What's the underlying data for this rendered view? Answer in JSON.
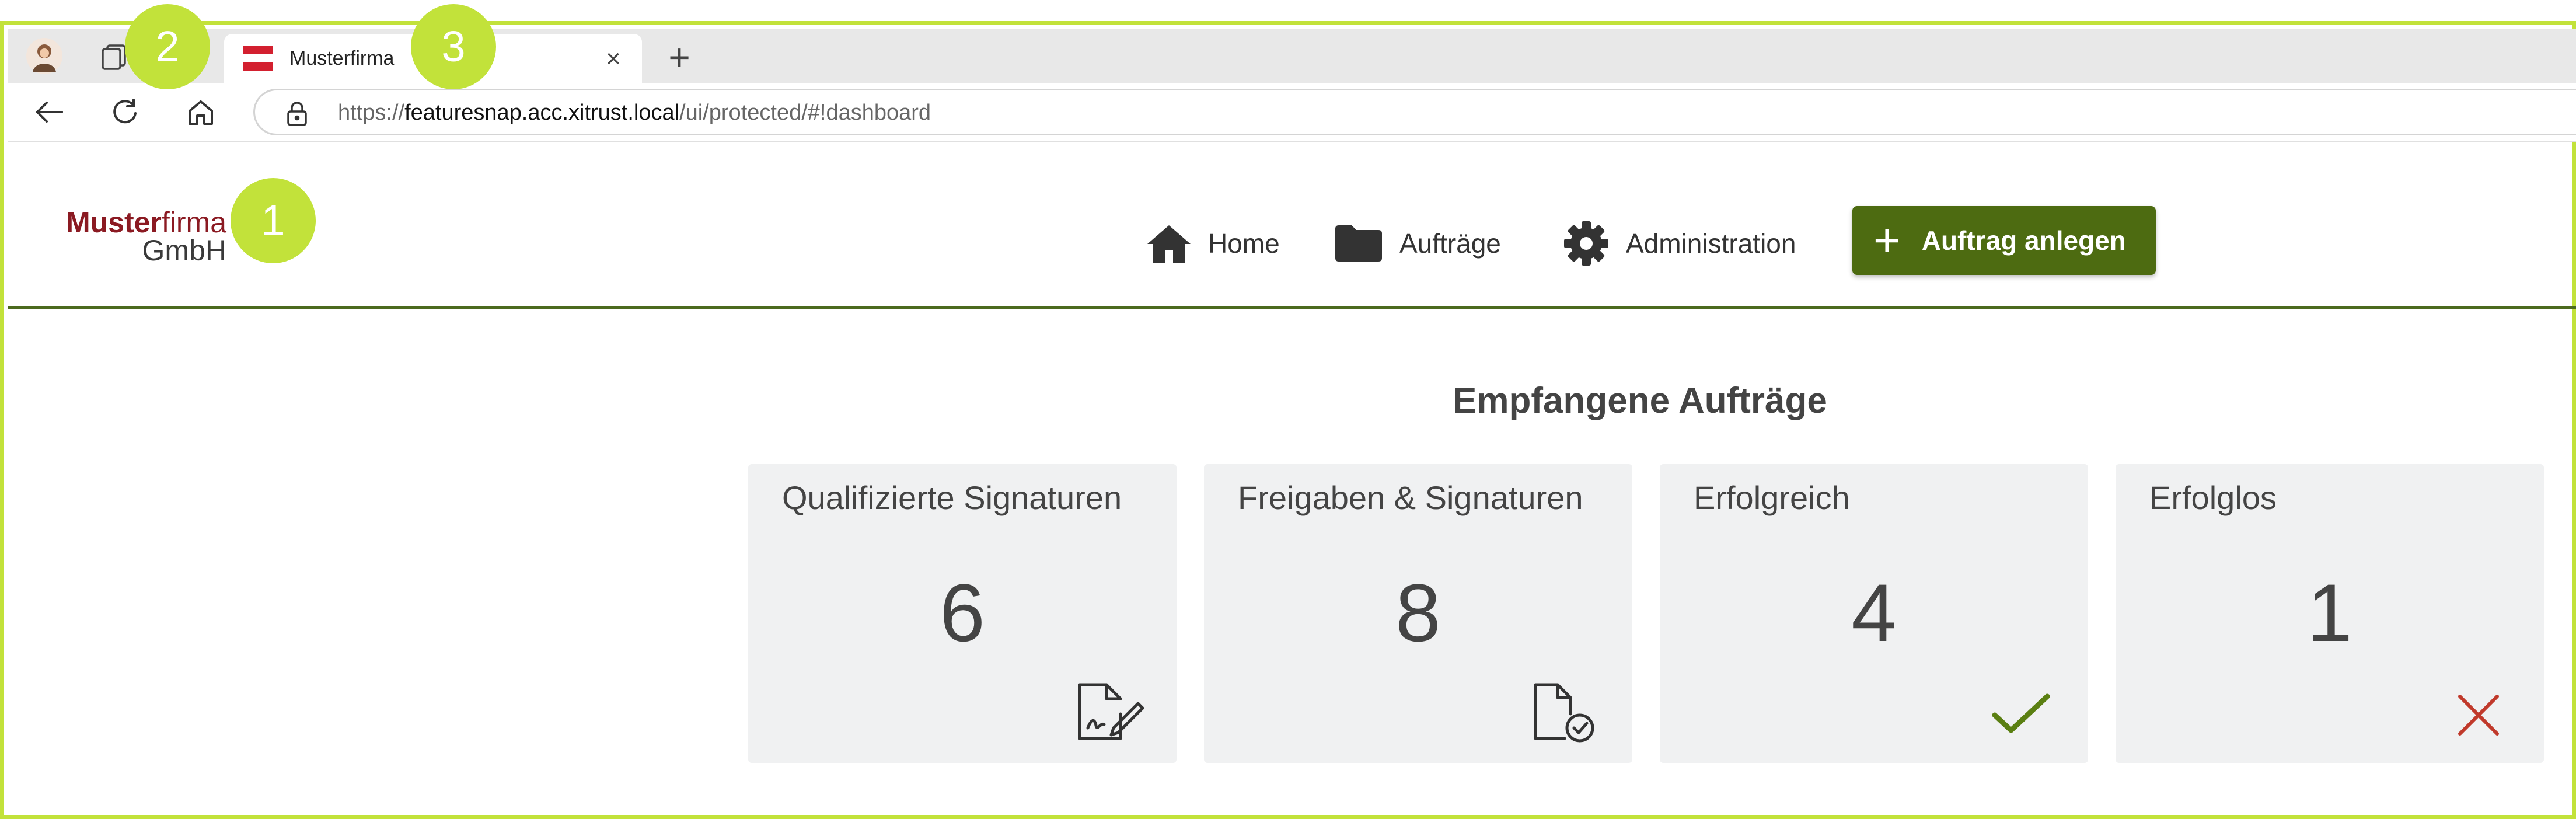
{
  "browser": {
    "tab_title": "Musterfirma",
    "tab_close": "×",
    "new_tab": "+",
    "url_scheme": "https://",
    "url_host": "featuresnap.acc.xitrust.local",
    "url_path": "/ui/protected/#!dashboard"
  },
  "header": {
    "logo_line1_bold": "Muster",
    "logo_line1_light": "firma",
    "logo_line2": "GmbH",
    "nav": [
      {
        "label": "Home",
        "icon": "home-icon"
      },
      {
        "label": "Aufträge",
        "icon": "folder-icon"
      },
      {
        "label": "Administration",
        "icon": "gear-icon"
      }
    ],
    "cta_label": "Auftrag anlegen",
    "cta_plus": "+"
  },
  "dashboard": {
    "title": "Empfangene Aufträge",
    "cards": [
      {
        "label": "Qualifizierte Signaturen",
        "value": "6",
        "icon": "signature-document-icon"
      },
      {
        "label": "Freigaben & Signaturen",
        "value": "8",
        "icon": "approved-document-icon"
      },
      {
        "label": "Erfolgreich",
        "value": "4",
        "icon": "checkmark-icon"
      },
      {
        "label": "Erfolglos",
        "value": "1",
        "icon": "cross-icon"
      }
    ]
  },
  "callouts": [
    "1",
    "2",
    "3"
  ],
  "colors": {
    "accent_green": "#4d6b11",
    "callout": "#c2e23a",
    "brand_red": "#8b1a22",
    "success": "#5a7f12",
    "failure": "#c0392b"
  }
}
